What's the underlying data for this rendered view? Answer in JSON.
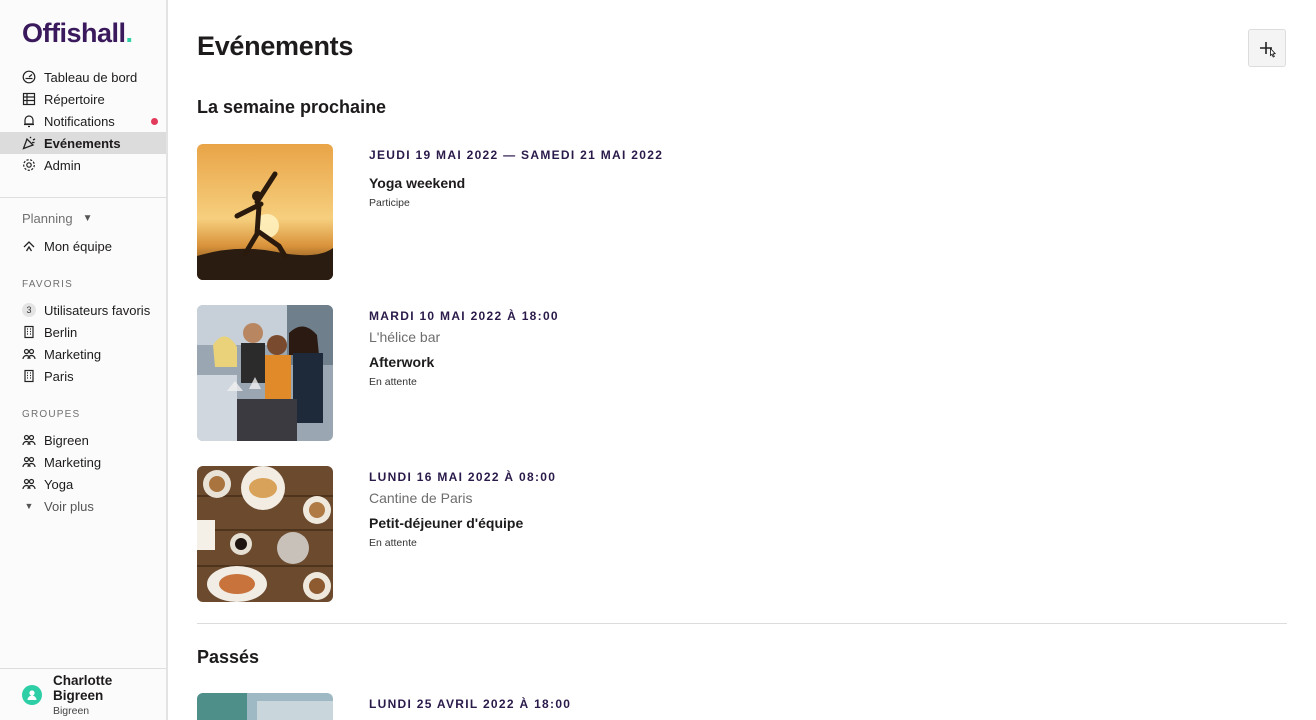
{
  "app": {
    "logo_text": "Offishall",
    "logo_dot": ".",
    "brand_color": "#3a1a5c",
    "accent_color": "#2ecfa6"
  },
  "sidebar": {
    "nav": [
      {
        "label": "Tableau de bord",
        "icon": "dashboard-icon"
      },
      {
        "label": "Répertoire",
        "icon": "directory-icon"
      },
      {
        "label": "Notifications",
        "icon": "bell-icon",
        "has_alert_dot": true
      },
      {
        "label": "Evénements",
        "icon": "party-icon",
        "active": true
      },
      {
        "label": "Admin",
        "icon": "gear-icon"
      }
    ],
    "planning": {
      "label": "Planning"
    },
    "team": {
      "label": "Mon équipe",
      "icon": "team-icon"
    },
    "favorites": {
      "label": "FAVORIS",
      "items": [
        {
          "label": "Utilisateurs favoris",
          "count": "3"
        },
        {
          "label": "Berlin",
          "icon": "building-icon"
        },
        {
          "label": "Marketing",
          "icon": "people-icon"
        },
        {
          "label": "Paris",
          "icon": "building-icon"
        }
      ]
    },
    "groups": {
      "label": "GROUPES",
      "items": [
        {
          "label": "Bigreen",
          "icon": "people-icon"
        },
        {
          "label": "Marketing",
          "icon": "people-icon"
        },
        {
          "label": "Yoga",
          "icon": "people-icon"
        }
      ],
      "more_label": "Voir plus"
    },
    "user": {
      "name": "Charlotte Bigreen",
      "org": "Bigreen"
    }
  },
  "main": {
    "title": "Evénements",
    "add_icon": "plus-icon",
    "upcoming": {
      "title": "La semaine prochaine",
      "events": [
        {
          "date": "JEUDI 19 MAI 2022 — SAMEDI 21 MAI 2022",
          "place": "",
          "title": "Yoga weekend",
          "status": "Participe"
        },
        {
          "date": "MARDI 10 MAI 2022 À 18:00",
          "place": "L'hélice bar",
          "title": "Afterwork",
          "status": "En attente"
        },
        {
          "date": "LUNDI 16 MAI 2022 À 08:00",
          "place": "Cantine de Paris",
          "title": "Petit-déjeuner d'équipe",
          "status": "En attente"
        }
      ]
    },
    "past": {
      "title": "Passés",
      "events": [
        {
          "date": "LUNDI 25 AVRIL 2022 À 18:00"
        }
      ]
    }
  }
}
